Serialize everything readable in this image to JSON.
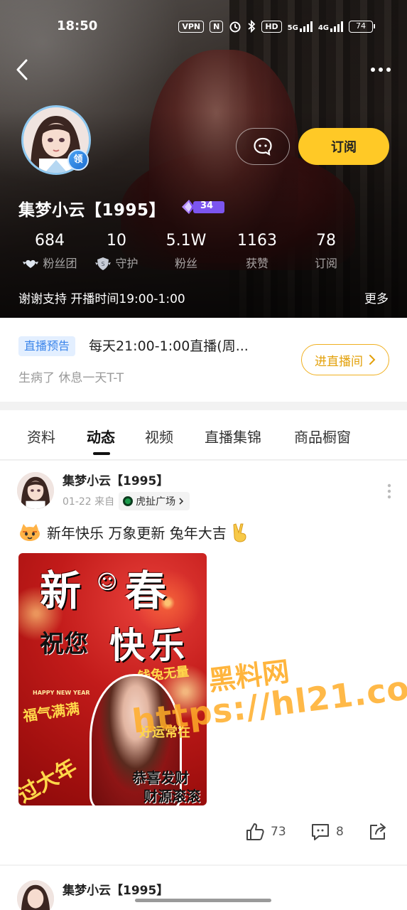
{
  "status_bar": {
    "time": "18:50",
    "vpn": "VPN",
    "nfc": "N",
    "hd": "HD",
    "net1": "5G",
    "net2": "4G",
    "battery": "74"
  },
  "header": {
    "back_icon": "chevron-left-icon",
    "more_icon": "more-horizontal-icon"
  },
  "profile": {
    "name": "集梦小云【1995】",
    "avatar_badge": "领",
    "level": "34",
    "message_icon": "chat-bubble-icon",
    "subscribe_label": "订阅",
    "stats": [
      {
        "value": "684",
        "label": "粉丝团",
        "icon": "heart-wings-icon"
      },
      {
        "value": "10",
        "label": "守护",
        "icon": "shield-icon"
      },
      {
        "value": "5.1W",
        "label": "粉丝"
      },
      {
        "value": "1163",
        "label": "获赞"
      },
      {
        "value": "78",
        "label": "订阅"
      }
    ],
    "bio": "谢谢支持 开播时间19:00-1:00",
    "more_label": "更多"
  },
  "live_notice": {
    "tag": "直播预告",
    "title": "每天21:00-1:00直播(周...",
    "subtitle": "生病了 休息一天T-T",
    "enter_label": "进直播间"
  },
  "tabs": [
    {
      "label": "资料",
      "active": false
    },
    {
      "label": "动态",
      "active": true
    },
    {
      "label": "视频",
      "active": false
    },
    {
      "label": "直播集锦",
      "active": false
    },
    {
      "label": "商品橱窗",
      "active": false
    }
  ],
  "post": {
    "author": "集梦小云【1995】",
    "date": "01-22 来自",
    "source": "虎扯广场",
    "text": "新年快乐 万象更新 兔年大吉",
    "emoji_icon": "cat-face-icon",
    "victory_icon": "victory-hand-icon",
    "image_text": {
      "big1": "新",
      "big2": "春",
      "line2a": "祝您",
      "line2b": "快乐",
      "tag1": "钱兔无量",
      "tag2": "福气满满",
      "tag3": "好运常在",
      "tag4": "恭喜发财",
      "tag5": "财源滚滚",
      "tag6": "过大年",
      "small": "HAPPY NEW YEAR"
    },
    "likes": "73",
    "comments": "8"
  },
  "watermark": {
    "line1": "黑料网",
    "line2": "https://hl21.co"
  },
  "next_post": {
    "author": "集梦小云【1995】"
  }
}
